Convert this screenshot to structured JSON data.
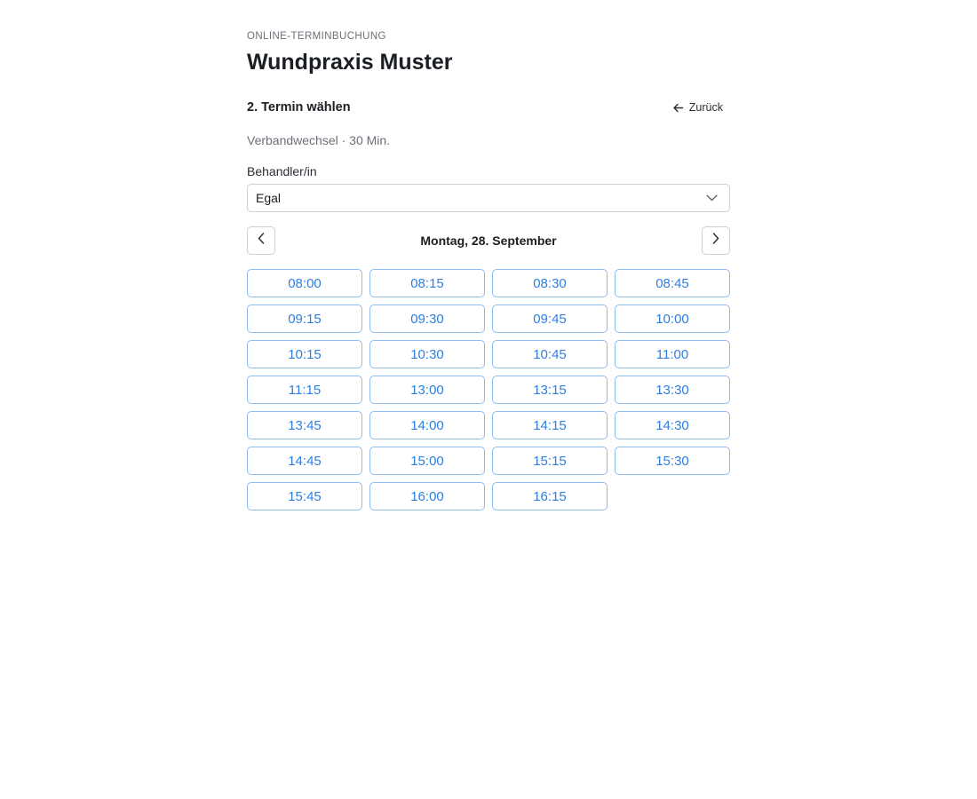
{
  "header": {
    "eyebrow": "ONLINE-TERMINBUCHUNG",
    "title": "Wundpraxis Muster"
  },
  "step": {
    "title": "2. Termin wählen",
    "back_label": "Zurück",
    "back_icon": "arrow-left-icon"
  },
  "service": {
    "info": "Verbandwechsel · 30 Min."
  },
  "practitioner": {
    "label": "Behandler/in",
    "selected": "Egal",
    "icon": "chevron-down-icon"
  },
  "date_nav": {
    "prev_icon": "chevron-left-icon",
    "next_icon": "chevron-right-icon",
    "current_date": "Montag, 28. September"
  },
  "slots": [
    "08:00",
    "08:15",
    "08:30",
    "08:45",
    "09:15",
    "09:30",
    "09:45",
    "10:00",
    "10:15",
    "10:30",
    "10:45",
    "11:00",
    "11:15",
    "13:00",
    "13:15",
    "13:30",
    "13:45",
    "14:00",
    "14:15",
    "14:30",
    "14:45",
    "15:00",
    "15:15",
    "15:30",
    "15:45",
    "16:00",
    "16:15"
  ],
  "colors": {
    "accent": "#2f7fe0",
    "slot_border": "#8fbcf0",
    "muted_text": "#6b7078"
  }
}
